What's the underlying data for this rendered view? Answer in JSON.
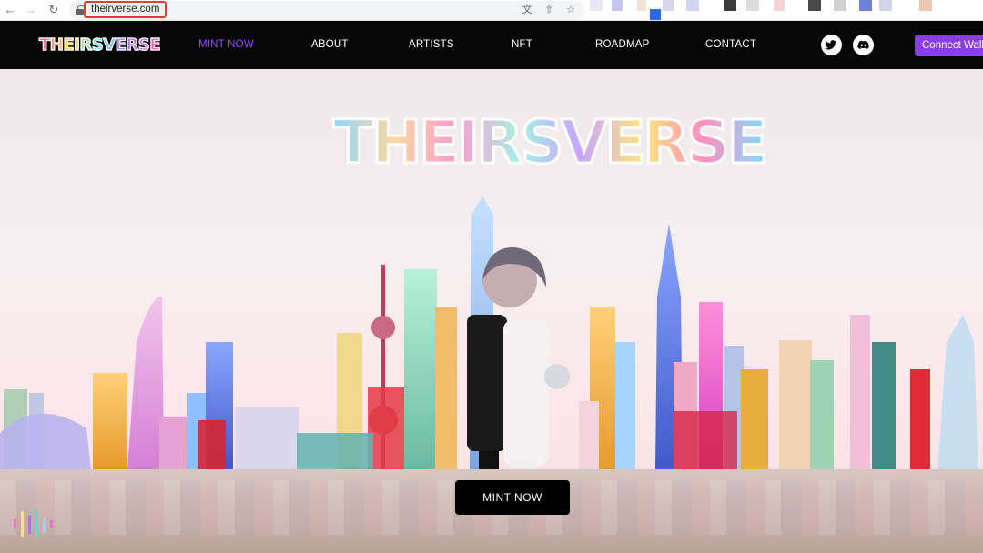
{
  "browser": {
    "url": "theirverse.com",
    "icons": [
      "back-icon",
      "forward-icon",
      "reload-icon",
      "lock-icon",
      "translate-icon",
      "share-icon",
      "bookmark-star-icon"
    ]
  },
  "site": {
    "logo_text": "THEIRSVERSE",
    "nav": [
      {
        "label": "MINT NOW",
        "active": true
      },
      {
        "label": "ABOUT",
        "active": false
      },
      {
        "label": "ARTISTS",
        "active": false
      },
      {
        "label": "NFT",
        "active": false
      },
      {
        "label": "ROADMAP",
        "active": false
      },
      {
        "label": "CONTACT",
        "active": false
      }
    ],
    "social": [
      "twitter-icon",
      "discord-icon"
    ],
    "connect_label": "Connect Walle",
    "colors": {
      "header_bg": "#060606",
      "accent": "#8a3cf0",
      "active_nav": "#9a4dff",
      "cta_bg": "#000000"
    }
  },
  "hero": {
    "title": "THEIRSVERSE",
    "cta_label": "MINT NOW"
  }
}
